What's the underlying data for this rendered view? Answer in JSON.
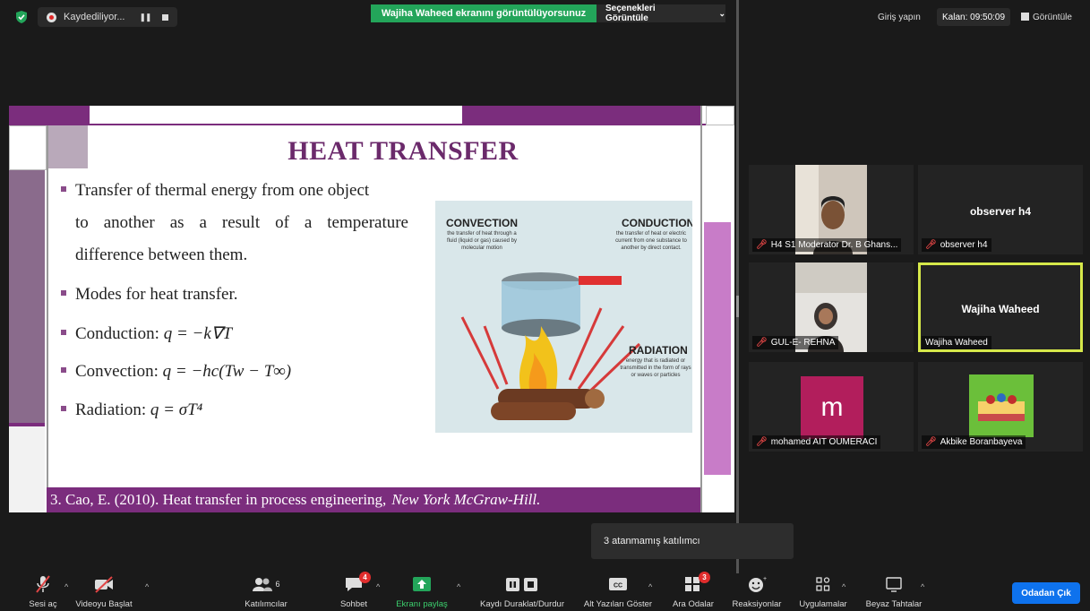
{
  "topbar": {
    "recording_label": "Kaydediliyor...",
    "share_banner": "Wajiha Waheed ekranını görüntülüyorsunuz",
    "view_options": "Seçenekleri Görüntüle",
    "sign_in": "Giriş yapın",
    "remaining": "Kalan: 09:50:09",
    "view": "Görüntüle"
  },
  "slide": {
    "title": "HEAT TRANSFER",
    "bullet1_l1": "Transfer of thermal energy from one object",
    "bullet1_l2": "to another as a result of a temperature",
    "bullet1_l3": "difference between them.",
    "bullet2": "Modes for heat transfer.",
    "bullet3_label": "Conduction:",
    "bullet3_formula": "q = −k∇T",
    "bullet4_label": "Convection:",
    "bullet4_formula": "q = −hc(Tw − T∞)",
    "bullet5_label": "Radiation:",
    "bullet5_formula": "q = σT⁴",
    "diagram": {
      "convection": "CONVECTION",
      "convection_desc": "the transfer of heat through a fluid (liquid or gas) caused by molecular motion",
      "conduction": "CONDUCTION",
      "conduction_desc": "the transfer of heat or electric current from one substance to another by direct contact.",
      "radiation": "RADIATION",
      "radiation_desc": "energy that is radiated or transmitted in the form of rays or waves or particles"
    },
    "reference": "3. Cao, E. (2010). Heat transfer in process engineering,",
    "reference_italic": "New York McGraw-Hill."
  },
  "participants": [
    {
      "name": "H4 S1 Moderator Dr. B Ghans...",
      "big": ""
    },
    {
      "name": "observer h4",
      "big": "observer h4"
    },
    {
      "name": "GUL-E- REHNA",
      "big": ""
    },
    {
      "name": "Wajiha Waheed",
      "big": "Wajiha Waheed"
    },
    {
      "name": "mohamed AIT OUMERACI",
      "big": "m"
    },
    {
      "name": "Akbike Boranbayeva",
      "big": ""
    }
  ],
  "popup": "3 atanmamış katılımcı",
  "toolbar": {
    "mute": "Sesi aç",
    "video": "Videoyu Başlat",
    "participants": "Katılımcılar",
    "participants_count": "6",
    "chat": "Sohbet",
    "chat_badge": "4",
    "share": "Ekranı paylaş",
    "record": "Kaydı Duraklat/Durdur",
    "captions": "Alt Yazıları Göster",
    "breakout": "Ara Odalar",
    "breakout_badge": "3",
    "reactions": "Reaksiyonlar",
    "apps": "Uygulamalar",
    "whiteboards": "Beyaz Tahtalar",
    "leave": "Odadan Çık"
  },
  "colors": {
    "accent_green": "#23a55a",
    "slide_purple": "#7b2d7d",
    "leave_blue": "#0e72ed",
    "badge_red": "#e02d2d"
  }
}
